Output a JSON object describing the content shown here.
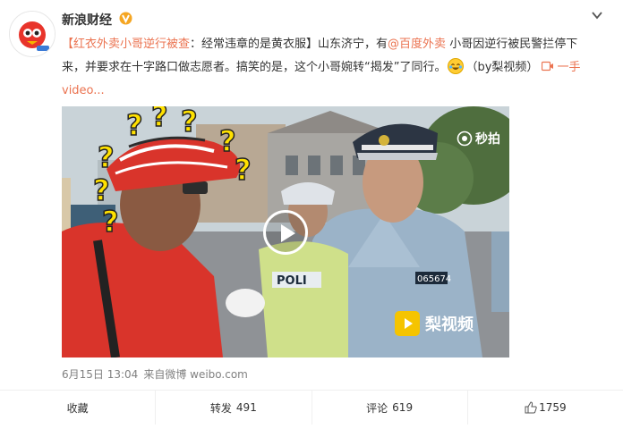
{
  "account": {
    "name": "新浪财经"
  },
  "post": {
    "prefix": "【",
    "headline": "红衣外卖小哥逆行被查",
    "subtitle": "：经常违章的是黄衣服】山东济宁，有",
    "mention": "@百度外卖",
    "body1": " 小哥因逆行被民警拦停下来，并要求在十字路口做志愿者。搞笑的是，这个小哥婉转“揭发”了同行。",
    "body2": "（by梨视频）",
    "video_link": "一手video..."
  },
  "video": {
    "watermark": "秒拍",
    "brand": "梨视频",
    "badge_number": "065674",
    "police_text": "POLI"
  },
  "meta": {
    "date": "6月15日 13:04",
    "source_prefix": "来自",
    "source": "微博 weibo.com"
  },
  "actions": {
    "favorite_label": "收藏",
    "repost_label": "转发",
    "repost_count": "491",
    "comment_label": "评论",
    "comment_count": "619",
    "like_count": "1759"
  },
  "colors": {
    "accent": "#eb7350",
    "link_blue": "#4a90d9",
    "verified": "#f5a623",
    "helmet_red": "#d9342b",
    "question_yellow": "#ffe100"
  }
}
